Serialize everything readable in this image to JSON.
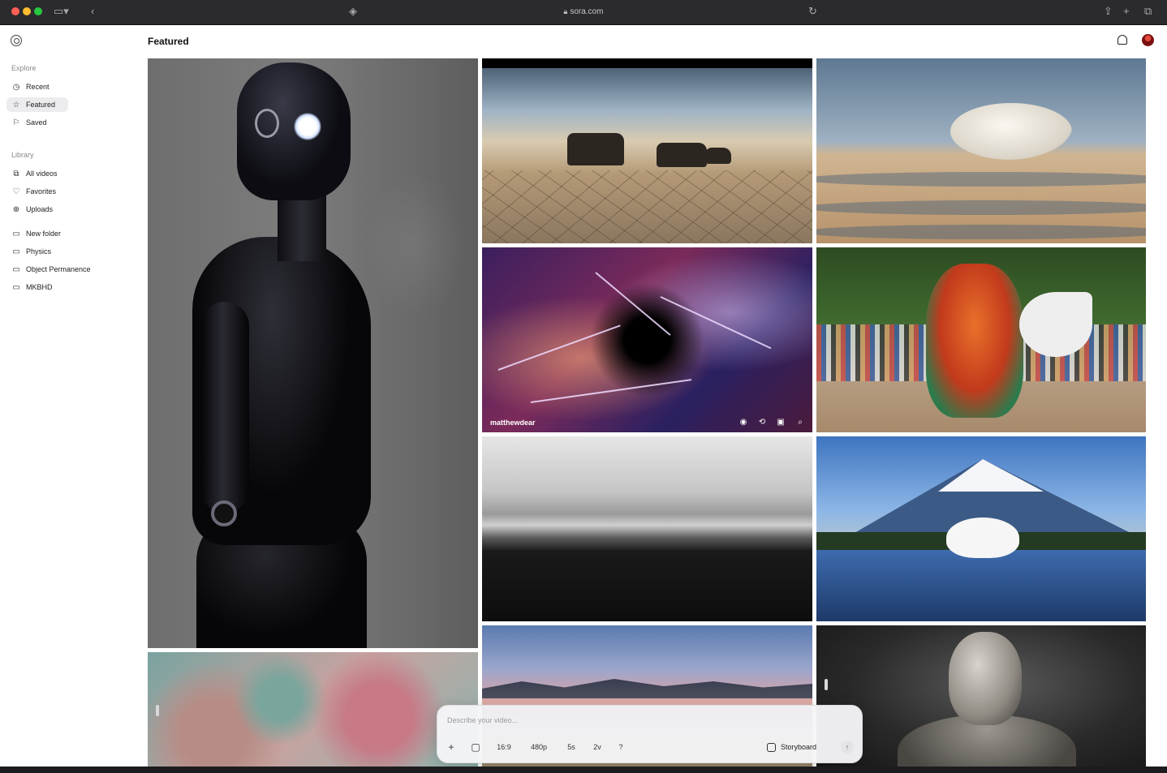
{
  "browser": {
    "url": "sora.com"
  },
  "header": {
    "title": "Featured"
  },
  "sidebar": {
    "explore_label": "Explore",
    "explore_items": [
      {
        "label": "Recent",
        "icon": "clock-icon"
      },
      {
        "label": "Featured",
        "icon": "star-icon",
        "active": true
      },
      {
        "label": "Saved",
        "icon": "bookmark-icon"
      }
    ],
    "library_label": "Library",
    "library_items": [
      {
        "label": "All videos",
        "icon": "videos-icon"
      },
      {
        "label": "Favorites",
        "icon": "heart-icon"
      },
      {
        "label": "Uploads",
        "icon": "upload-icon"
      }
    ],
    "folders": [
      {
        "label": "New folder",
        "icon": "folder-icon"
      },
      {
        "label": "Physics",
        "icon": "folder-icon"
      },
      {
        "label": "Object Permanence",
        "icon": "folder-icon"
      },
      {
        "label": "MKBHD",
        "icon": "folder-icon"
      }
    ]
  },
  "grid": {
    "hovered_creator": "matthewdear"
  },
  "composer": {
    "placeholder": "Describe your video...",
    "aspect_ratio": "16:9",
    "resolution": "480p",
    "duration": "5s",
    "variations": "2v",
    "help": "?",
    "storyboard_label": "Storyboard"
  },
  "colors": {
    "accent_active_bg": "#ececee",
    "chrome_bg": "#2b2b2d"
  }
}
